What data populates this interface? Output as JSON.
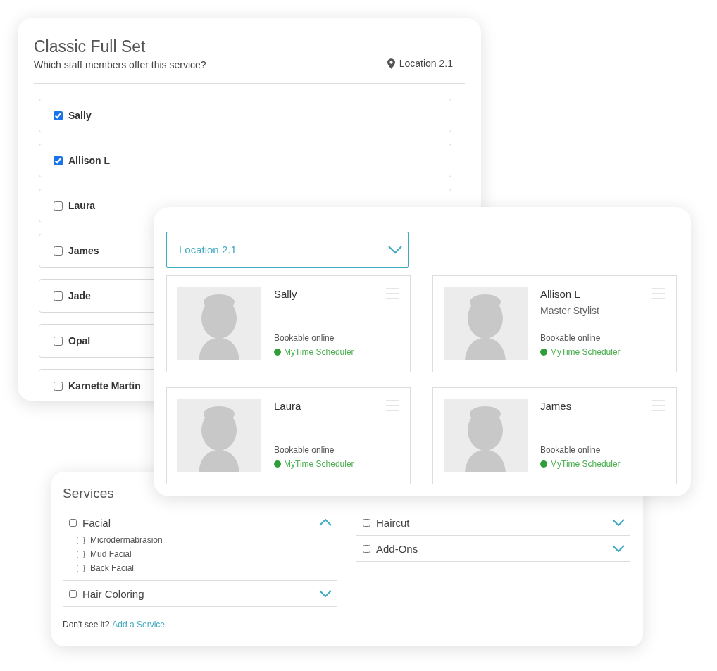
{
  "staff_panel": {
    "title": "Classic Full Set",
    "subtitle": "Which staff members offer this service?",
    "location": "Location 2.1",
    "staff": [
      {
        "name": "Sally",
        "checked": true
      },
      {
        "name": "Allison L",
        "checked": true
      },
      {
        "name": "Laura",
        "checked": false
      },
      {
        "name": "James",
        "checked": false
      },
      {
        "name": "Jade",
        "checked": false
      },
      {
        "name": "Opal",
        "checked": false
      },
      {
        "name": "Karnette Martin",
        "checked": false
      }
    ]
  },
  "location_panel": {
    "location_select": {
      "value": "Location 2.1"
    },
    "staff_cards": [
      {
        "name": "Sally",
        "booking": "Bookable online",
        "scheduler": "MyTime Scheduler"
      },
      {
        "name": "Allison L",
        "role": "Master Stylist",
        "booking": "Bookable online",
        "scheduler": "MyTime Scheduler"
      },
      {
        "name": "Laura",
        "booking": "Bookable online",
        "scheduler": "MyTime Scheduler"
      },
      {
        "name": "James",
        "booking": "Bookable online",
        "scheduler": "MyTime Scheduler"
      }
    ]
  },
  "services_panel": {
    "title": "Services",
    "columns": [
      [
        {
          "name": "Facial",
          "checked": false,
          "expanded": true,
          "children": [
            {
              "name": "Microdermabrasion",
              "checked": false
            },
            {
              "name": "Mud Facial",
              "checked": false
            },
            {
              "name": "Back Facial",
              "checked": false
            }
          ]
        },
        {
          "name": "Hair Coloring",
          "checked": false,
          "expanded": false
        }
      ],
      [
        {
          "name": "Haircut",
          "checked": false,
          "expanded": false
        },
        {
          "name": "Add-Ons",
          "checked": false,
          "expanded": false
        }
      ]
    ],
    "footer_prompt": "Don't see it?",
    "footer_link": "Add a Service"
  }
}
